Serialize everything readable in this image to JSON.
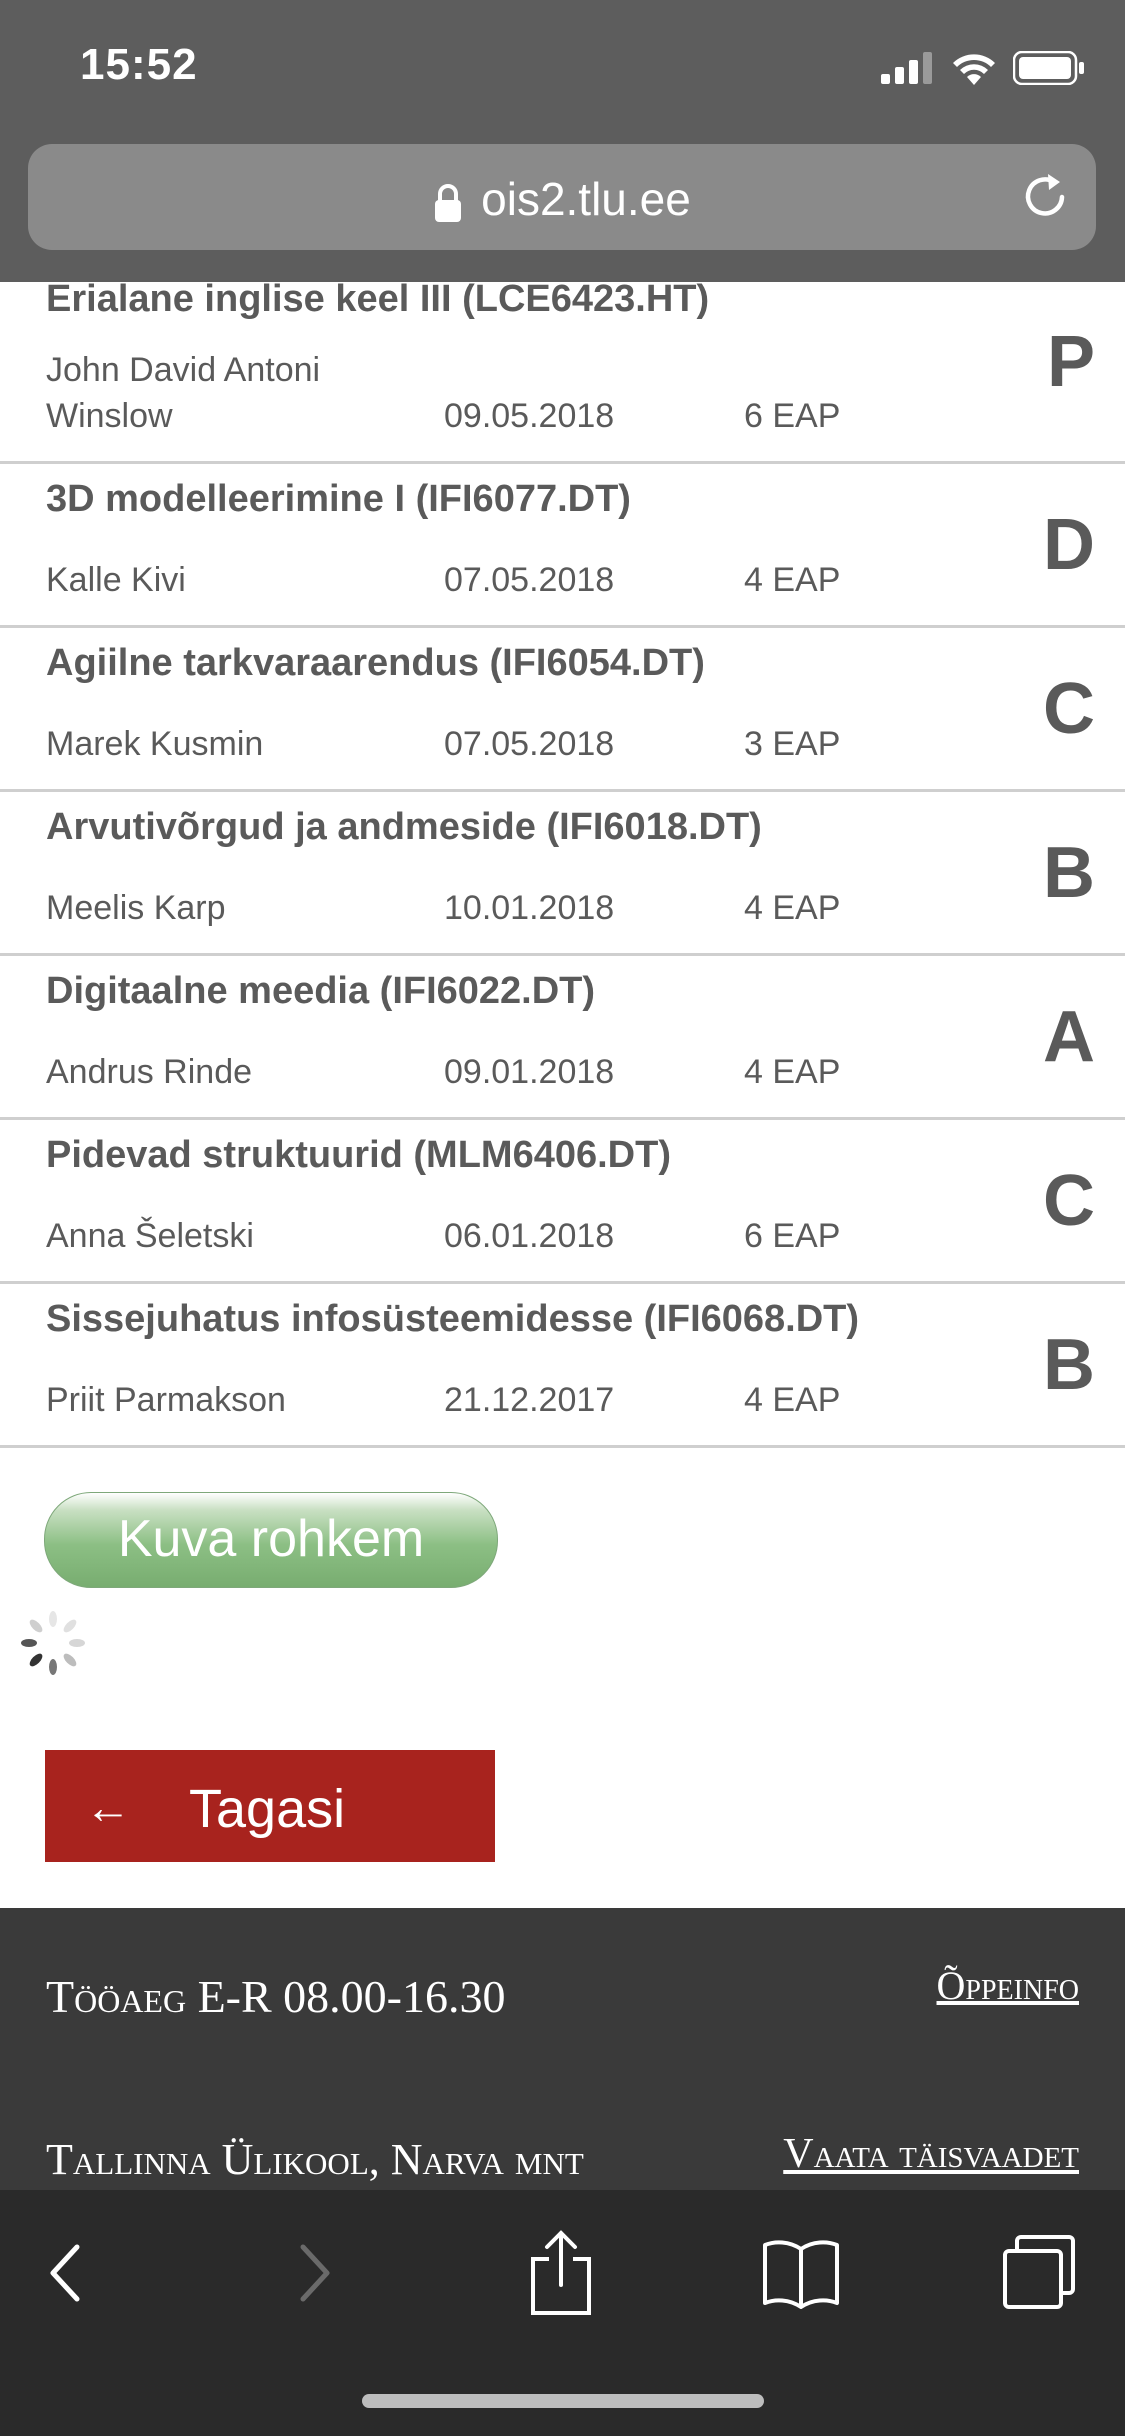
{
  "status_bar": {
    "time": "15:52"
  },
  "browser": {
    "url": "ois2.tlu.ee"
  },
  "courses": [
    {
      "title": "Erialane inglise keel III (LCE6423.HT)",
      "teacher": "John David Antoni Winslow",
      "date": "09.05.2018",
      "credits": "6 EAP",
      "grade": "P"
    },
    {
      "title": "3D modelleerimine I (IFI6077.DT)",
      "teacher": "Kalle Kivi",
      "date": "07.05.2018",
      "credits": "4 EAP",
      "grade": "D"
    },
    {
      "title": "Agiilne tarkvaraarendus (IFI6054.DT)",
      "teacher": "Marek Kusmin",
      "date": "07.05.2018",
      "credits": "3 EAP",
      "grade": "C"
    },
    {
      "title": "Arvutivõrgud ja andmeside (IFI6018.DT)",
      "teacher": "Meelis Karp",
      "date": "10.01.2018",
      "credits": "4 EAP",
      "grade": "B"
    },
    {
      "title": "Digitaalne meedia (IFI6022.DT)",
      "teacher": "Andrus Rinde",
      "date": "09.01.2018",
      "credits": "4 EAP",
      "grade": "A"
    },
    {
      "title": "Pidevad struktuurid (MLM6406.DT)",
      "teacher": "Anna Šeletski",
      "date": "06.01.2018",
      "credits": "6 EAP",
      "grade": "C"
    },
    {
      "title": "Sissejuhatus infosüsteemidesse (IFI6068.DT)",
      "teacher": "Priit Parmakson",
      "date": "21.12.2017",
      "credits": "4 EAP",
      "grade": "B"
    }
  ],
  "buttons": {
    "show_more": "Kuva rohkem",
    "back_arrow": "←",
    "back": "Tagasi"
  },
  "footer": {
    "hours": "Tööaeg E-R 08.00-16.30",
    "study_info_link": "Õppeinfo",
    "address": "Tallinna Ülikool, Narva mnt",
    "full_view_link": "Vaata täisvaadet"
  },
  "colors": {
    "header_bg": "#5d5d5d",
    "back_button": "#a8231e",
    "show_more_button": "#8cbf84",
    "footer_bg": "#3a3a3a",
    "toolbar_bg": "#2a2a2a"
  },
  "toolbar": {
    "icons": [
      "back-icon",
      "forward-icon",
      "share-icon",
      "bookmarks-icon",
      "tabs-icon"
    ]
  }
}
